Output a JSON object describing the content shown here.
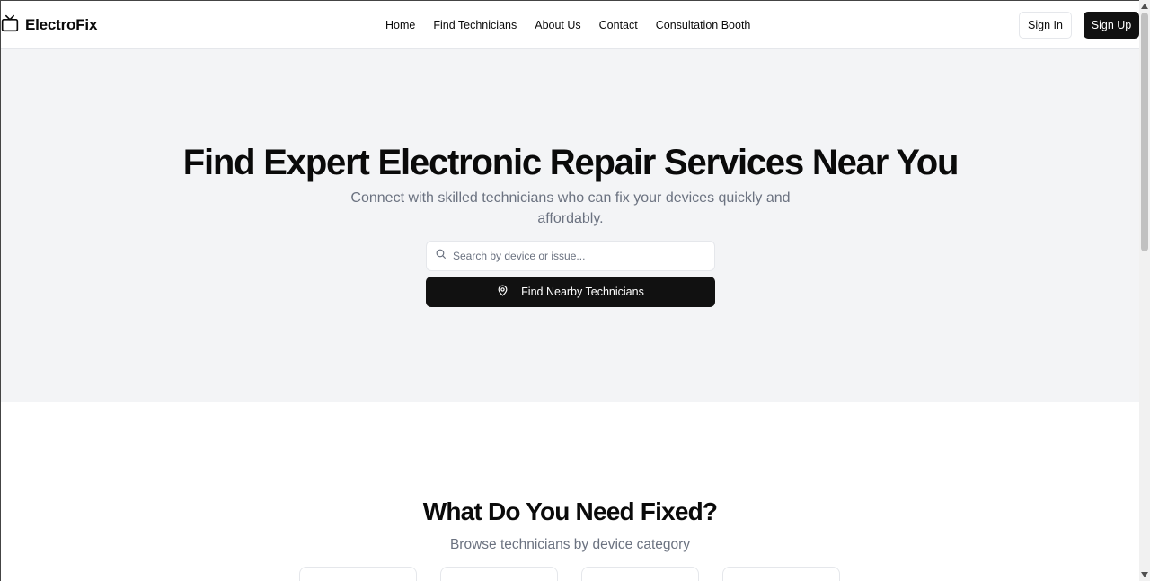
{
  "header": {
    "brand": "ElectroFix",
    "brand_icon": "tv-icon",
    "nav": [
      "Home",
      "Find Technicians",
      "About Us",
      "Contact",
      "Consultation Booth"
    ],
    "sign_in": "Sign In",
    "sign_up": "Sign Up"
  },
  "hero": {
    "title": "Find Expert Electronic Repair Services Near You",
    "subtitle": "Connect with skilled technicians who can fix your devices quickly and affordably.",
    "search_placeholder": "Search by device or issue...",
    "search_icon": "search-icon",
    "find_button": "Find Nearby Technicians",
    "find_icon": "map-pin-icon"
  },
  "categories": {
    "title": "What Do You Need Fixed?",
    "subtitle": "Browse technicians by device category"
  },
  "colors": {
    "primary": "#111111",
    "hero_bg": "#f3f4f6",
    "muted_text": "#6b7280",
    "border": "#e5e7eb"
  }
}
